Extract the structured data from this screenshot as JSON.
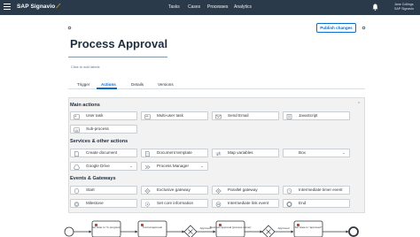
{
  "app": {
    "brand": "SAP Signavio",
    "nav": [
      "Tasks",
      "Cases",
      "Processes",
      "Analytics"
    ],
    "user_name": "Jane Collings",
    "user_org": "SAP Signavio"
  },
  "page": {
    "title": "Process Approval",
    "labels_hint": "Click to add labels",
    "publish_label": "Publish changes"
  },
  "tabs": [
    "Trigger",
    "Actions",
    "Details",
    "Versions"
  ],
  "active_tab": "Actions",
  "sections": {
    "main_actions": {
      "title": "Main actions",
      "items": [
        "User task",
        "Multi-user task",
        "Send Email",
        "JavaScript",
        "Sub-process"
      ]
    },
    "services": {
      "title": "Services & other actions",
      "items": [
        "Create document",
        "Document template",
        "Map variables",
        "Box",
        "Google Drive",
        "Process Manager"
      ]
    },
    "events": {
      "title": "Events & Gateways",
      "items": [
        "Start",
        "Exclusive gateway",
        "Parallel gateway",
        "Intermediate timer event",
        "Milestone",
        "Set core information",
        "Intermediate link event",
        "End"
      ]
    }
  },
  "diagram": {
    "tasks": [
      "Set state to \"in progress\"",
      "Formal approval",
      "Business approval (process owner)",
      "Set state to \"approved\""
    ],
    "edge_labels": [
      "Approved",
      "Approved"
    ]
  },
  "colors": {
    "topbar": "#2b3a4a",
    "accent": "#0a6ed1",
    "brand_swoosh": "#f0ab00",
    "task_marker": "#d04343"
  }
}
